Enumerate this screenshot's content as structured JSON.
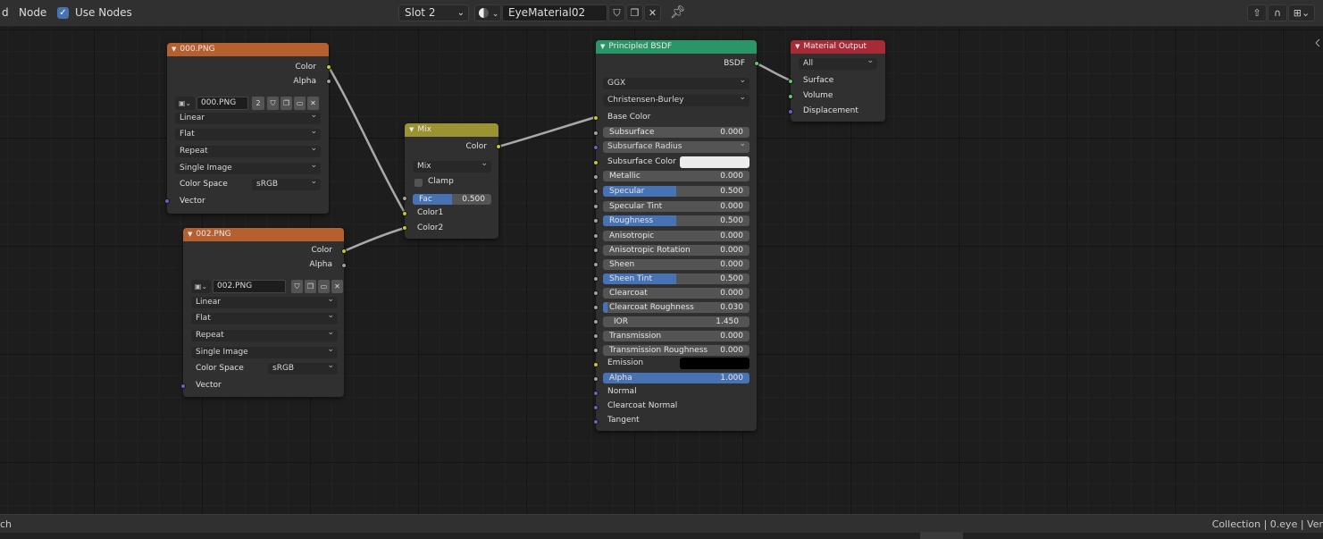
{
  "header": {
    "menu_fragment": "d",
    "node_menu": "Node",
    "use_nodes_label": "Use Nodes",
    "use_nodes_checked": true,
    "slot": "Slot 2",
    "material_name": "EyeMaterial02"
  },
  "nodes": {
    "img1": {
      "title": "000.PNG",
      "out_color": "Color",
      "out_alpha": "Alpha",
      "image_name": "000.PNG",
      "user_count": "2",
      "interpolation": "Linear",
      "projection": "Flat",
      "extension": "Repeat",
      "source": "Single Image",
      "color_space_label": "Color Space",
      "color_space": "sRGB",
      "in_vector": "Vector"
    },
    "img2": {
      "title": "002.PNG",
      "out_color": "Color",
      "out_alpha": "Alpha",
      "image_name": "002.PNG",
      "interpolation": "Linear",
      "projection": "Flat",
      "extension": "Repeat",
      "source": "Single Image",
      "color_space_label": "Color Space",
      "color_space": "sRGB",
      "in_vector": "Vector"
    },
    "mix": {
      "title": "Mix",
      "out_color": "Color",
      "blend_type": "Mix",
      "clamp_label": "Clamp",
      "fac_label": "Fac",
      "fac_value": "0.500",
      "fac_fraction": 0.5,
      "in_color1": "Color1",
      "in_color2": "Color2"
    },
    "bsdf": {
      "title": "Principled BSDF",
      "out_bsdf": "BSDF",
      "distribution": "GGX",
      "subsurface_method": "Christensen-Burley",
      "base_color": "Base Color",
      "subsurface": {
        "label": "Subsurface",
        "value": "0.000",
        "fraction": 0
      },
      "subsurface_radius": "Subsurface Radius",
      "subsurface_color": "Subsurface Color",
      "subsurface_color_hex": "#ececec",
      "metallic": {
        "label": "Metallic",
        "value": "0.000",
        "fraction": 0
      },
      "specular": {
        "label": "Specular",
        "value": "0.500",
        "fraction": 0.5
      },
      "specular_tint": {
        "label": "Specular Tint",
        "value": "0.000",
        "fraction": 0
      },
      "roughness": {
        "label": "Roughness",
        "value": "0.500",
        "fraction": 0.5
      },
      "anisotropic": {
        "label": "Anisotropic",
        "value": "0.000",
        "fraction": 0
      },
      "anisotropic_rotation": {
        "label": "Anisotropic Rotation",
        "value": "0.000",
        "fraction": 0
      },
      "sheen": {
        "label": "Sheen",
        "value": "0.000",
        "fraction": 0
      },
      "sheen_tint": {
        "label": "Sheen Tint",
        "value": "0.500",
        "fraction": 0.5
      },
      "clearcoat": {
        "label": "Clearcoat",
        "value": "0.000",
        "fraction": 0
      },
      "clearcoat_roughness": {
        "label": "Clearcoat Roughness",
        "value": "0.030",
        "fraction": 0.03
      },
      "ior": {
        "label": "IOR",
        "value": "1.450"
      },
      "transmission": {
        "label": "Transmission",
        "value": "0.000",
        "fraction": 0
      },
      "transmission_roughness": {
        "label": "Transmission Roughness",
        "value": "0.000",
        "fraction": 0
      },
      "emission": "Emission",
      "emission_hex": "#000000",
      "alpha": {
        "label": "Alpha",
        "value": "1.000",
        "fraction": 1
      },
      "normal": "Normal",
      "clearcoat_normal": "Clearcoat Normal",
      "tangent": "Tangent"
    },
    "output": {
      "title": "Material Output",
      "target": "All",
      "in_surface": "Surface",
      "in_volume": "Volume",
      "in_displacement": "Displacement"
    }
  },
  "colors": {
    "texture_header": "#b65f2f",
    "mix_header": "#9b9232",
    "shader_header": "#299667",
    "output_header": "#a92a37",
    "socket_color": "#c7c729",
    "socket_float": "#a1a1a1",
    "socket_vector": "#6363c7",
    "socket_shader": "#63c763",
    "slider_fill": "#4772b3"
  },
  "status": {
    "left_fragment": "ch",
    "right_text": "Collection | 0.eye | Ver"
  }
}
